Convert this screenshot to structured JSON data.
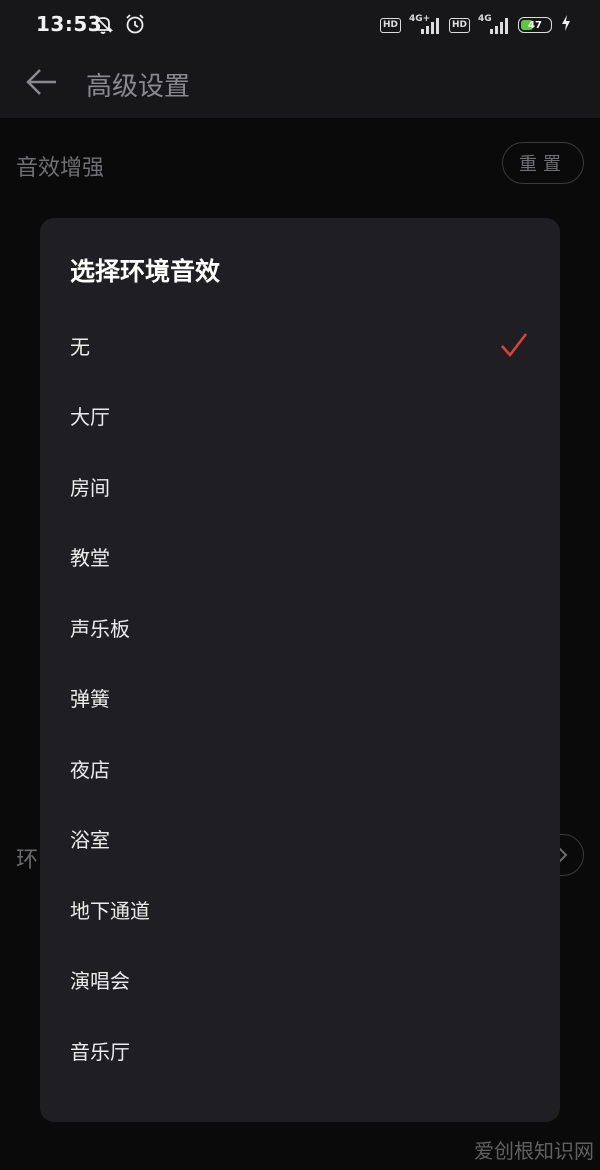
{
  "status_bar": {
    "time": "13:53",
    "hd1": "HD",
    "net1": "4G+",
    "hd2": "HD",
    "net2": "4G",
    "battery_level": "47",
    "battery_fraction": 0.47,
    "icons": [
      "mute-icon",
      "alarm-icon",
      "signal-icon",
      "charging-icon"
    ]
  },
  "header": {
    "title": "高级设置"
  },
  "background": {
    "section_label": "音效增强",
    "reset_label": "重置",
    "partial_label": "环"
  },
  "dialog": {
    "title": "选择环境音效",
    "options": [
      "无",
      "大厅",
      "房间",
      "教堂",
      "声乐板",
      "弹簧",
      "夜店",
      "浴室",
      "地下通道",
      "演唱会",
      "音乐厅"
    ],
    "selected_index": 0
  },
  "watermark": "爱创根知识网",
  "colors": {
    "accent": "#e0413f",
    "dialog_bg": "#1f1f23",
    "battery": "#5cc83f"
  }
}
